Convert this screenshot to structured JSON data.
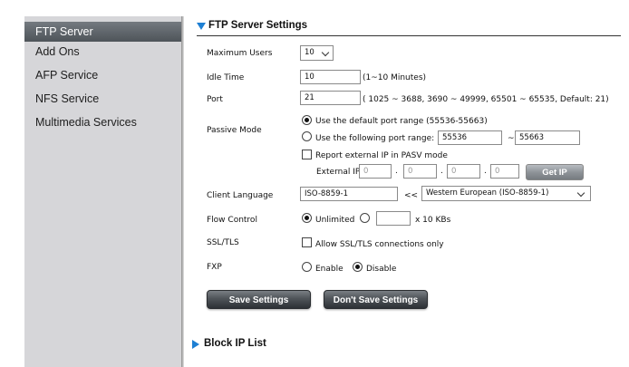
{
  "sidebar": {
    "items": [
      {
        "label": "FTP Server",
        "active": true
      },
      {
        "label": "Add Ons"
      },
      {
        "label": "AFP Service"
      },
      {
        "label": "NFS Service"
      },
      {
        "label": "Multimedia Services"
      }
    ]
  },
  "ftp": {
    "title": "FTP Server Settings",
    "max_users": {
      "label": "Maximum Users",
      "value": "10"
    },
    "idle_time": {
      "label": "Idle Time",
      "value": "10",
      "hint": "(1~10 Minutes)"
    },
    "port": {
      "label": "Port",
      "value": "21",
      "hint": "( 1025 ~ 3688, 3690 ~ 49999, 65501 ~ 65535, Default: 21)"
    },
    "passive": {
      "label": "Passive Mode",
      "default_option": "Use the default port range (55536-55663)",
      "custom_option": "Use the following port range:",
      "range_start": "55536",
      "range_sep": "~",
      "range_end": "55663",
      "report_label": "Report external IP in PASV mode",
      "external_ip_label": "External IP :",
      "ip": [
        "0",
        "0",
        "0",
        "0"
      ],
      "dot": ".",
      "get_ip": "Get IP"
    },
    "client_language": {
      "label": "Client Language",
      "value": "ISO-8859-1",
      "arrow": "<<",
      "option": "Western European (ISO-8859-1)"
    },
    "flow_control": {
      "label": "Flow Control",
      "unlimited": "Unlimited",
      "unit": "x 10 KBs",
      "value": ""
    },
    "ssl": {
      "label": "SSL/TLS",
      "option": "Allow SSL/TLS connections only"
    },
    "fxp": {
      "label": "FXP",
      "enable": "Enable",
      "disable": "Disable"
    },
    "save_label": "Save Settings",
    "dont_save_label": "Don't Save Settings"
  },
  "block": {
    "title": "Block IP List"
  },
  "colors": {
    "accent": "#1d7fd3",
    "sidebar_bg": "#d6d6d9",
    "active_item": "#5e6469"
  }
}
